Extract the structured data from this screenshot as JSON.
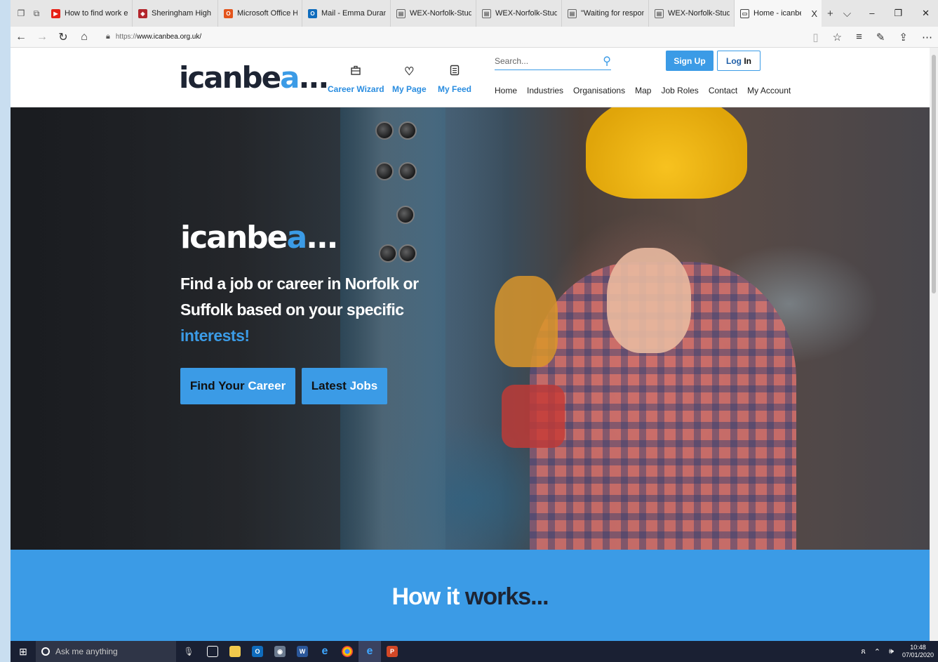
{
  "browser": {
    "tabs": [
      {
        "label": "How to find work experi",
        "favicon_color": "#e62117",
        "favicon": "youtube-icon"
      },
      {
        "label": "Sheringham High Schoo",
        "favicon_color": "#b3262c",
        "favicon": "school-crest-icon"
      },
      {
        "label": "Microsoft Office Home",
        "favicon_color": "#e3541b",
        "favicon": "office-icon"
      },
      {
        "label": "Mail - Emma Durand - (",
        "favicon_color": "#0f6cbd",
        "favicon": "outlook-icon"
      },
      {
        "label": "WEX-Norfolk-Student-F",
        "favicon_color": "#666666",
        "favicon": "document-icon"
      },
      {
        "label": "WEX-Norfolk-Student-F",
        "favicon_color": "#666666",
        "favicon": "document-icon"
      },
      {
        "label": "\"Waiting for response fr",
        "favicon_color": "#666666",
        "favicon": "document-icon"
      },
      {
        "label": "WEX-Norfolk-Student-F",
        "favicon_color": "#666666",
        "favicon": "document-icon"
      }
    ],
    "active_tab": {
      "label": "Home - icanbea...",
      "close": "X"
    },
    "url_prefix": "https://",
    "url_host": "www.icanbea.org.uk/"
  },
  "site": {
    "logo": {
      "dark": "icanbe",
      "blue": "a",
      "dots": "..."
    },
    "quick_links": [
      {
        "label": "Career Wizard",
        "icon": "briefcase-icon"
      },
      {
        "label": "My Page",
        "icon": "heart-icon"
      },
      {
        "label": "My Feed",
        "icon": "feed-list-icon"
      }
    ],
    "search_placeholder": "Search...",
    "sign_up": "Sign Up",
    "log_in": {
      "dark": "Log ",
      "strong": "In"
    },
    "nav": [
      "Home",
      "Industries",
      "Organisations",
      "Map",
      "Job Roles",
      "Contact",
      "My Account"
    ],
    "hero": {
      "tagline_line1": "Find a job or career in Norfolk or",
      "tagline_line2": "Suffolk based on your specific",
      "tagline_line3": "interests!",
      "cta1": {
        "dark": "Find Your ",
        "white": "Career"
      },
      "cta2": {
        "dark": "Latest ",
        "white": "Jobs"
      }
    },
    "how": {
      "white": "How it ",
      "dark": "works..."
    },
    "colors": {
      "brand_blue": "#3b9be6",
      "brand_dark": "#1d2433"
    }
  },
  "taskbar": {
    "search_placeholder": "Ask me anything",
    "time": "10:48",
    "date": "07/01/2020"
  }
}
